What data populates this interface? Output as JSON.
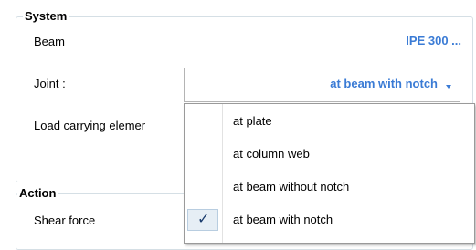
{
  "system": {
    "legend": "System",
    "beam_label": "Beam",
    "beam_value": "IPE 300 ...",
    "joint_label": "Joint :",
    "joint_value": "at beam with notch",
    "load_label": "Load carrying elemer"
  },
  "action": {
    "legend": "Action",
    "shear_label": "Shear force"
  },
  "dropdown": {
    "items": [
      {
        "label": "at plate",
        "checked": false
      },
      {
        "label": "at column web",
        "checked": false
      },
      {
        "label": "at beam without notch",
        "checked": false
      },
      {
        "label": "at beam with notch",
        "checked": true
      }
    ],
    "check_glyph": "✓"
  },
  "colors": {
    "accent": "#3a7bd5",
    "group_border": "#d5dfe5"
  }
}
